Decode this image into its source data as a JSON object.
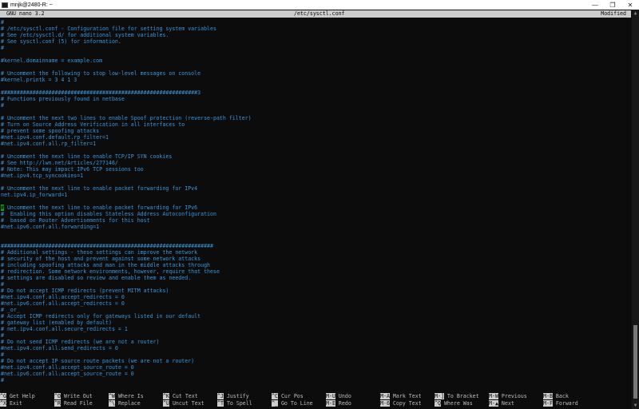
{
  "window": {
    "title": "mnjk@2480-R: ~",
    "minimize_glyph": "—",
    "maximize_glyph": "❐",
    "close_glyph": "✕"
  },
  "nano": {
    "version": "GNU nano 3.2",
    "filename": "/etc/sysctl.conf",
    "status": "Modified"
  },
  "editor": {
    "cursor_line_index": 29,
    "lines": [
      "#",
      "# /etc/sysctl.conf - Configuration file for setting system variables",
      "# See /etc/sysctl.d/ for additional system variables.",
      "# See sysctl.conf (5) for information.",
      "#",
      "",
      "#kernel.domainname = example.com",
      "",
      "# Uncomment the following to stop low-level messages on console",
      "#kernel.printk = 3 4 1 3",
      "",
      "##############################################################3",
      "# Functions previously found in netbase",
      "#",
      "",
      "# Uncomment the next two lines to enable Spoof protection (reverse-path filter)",
      "# Turn on Source Address Verification in all interfaces to",
      "# prevent some spoofing attacks",
      "#net.ipv4.conf.default.rp_filter=1",
      "#net.ipv4.conf.all.rp_filter=1",
      "",
      "# Uncomment the next line to enable TCP/IP SYN cookies",
      "# See http://lwn.net/Articles/277146/",
      "# Note: This may impact IPv6 TCP sessions too",
      "#net.ipv4.tcp_syncookies=1",
      "",
      "# Uncomment the next line to enable packet forwarding for IPv4",
      "net.ipv4.ip_forward=1",
      "",
      "# Uncomment the next line to enable packet forwarding for IPv6",
      "#  Enabling this option disables Stateless Address Autoconfiguration",
      "#  based on Router Advertisements for this host",
      "#net.ipv6.conf.all.forwarding=1",
      "",
      "",
      "###################################################################",
      "# Additional settings - these settings can improve the network",
      "# security of the host and prevent against some network attacks",
      "# including spoofing attacks and man in the middle attacks through",
      "# redirection. Some network environments, however, require that these",
      "# settings are disabled so review and enable them as needed.",
      "#",
      "# Do not accept ICMP redirects (prevent MITM attacks)",
      "#net.ipv4.conf.all.accept_redirects = 0",
      "#net.ipv6.conf.all.accept_redirects = 0",
      "# _or_",
      "# Accept ICMP redirects only for gateways listed in our default",
      "# gateway list (enabled by default)",
      "# net.ipv4.conf.all.secure_redirects = 1",
      "#",
      "# Do not send ICMP redirects (we are not a router)",
      "#net.ipv4.conf.all.send_redirects = 0",
      "#",
      "# Do not accept IP source route packets (we are not a router)",
      "#net.ipv4.conf.all.accept_source_route = 0",
      "#net.ipv6.conf.all.accept_source_route = 0",
      "#"
    ]
  },
  "shortcuts": [
    {
      "key": "^G",
      "label": "Get Help"
    },
    {
      "key": "^X",
      "label": "Exit"
    },
    {
      "key": "^O",
      "label": "Write Out"
    },
    {
      "key": "^R",
      "label": "Read File"
    },
    {
      "key": "^W",
      "label": "Where Is"
    },
    {
      "key": "^\\",
      "label": "Replace"
    },
    {
      "key": "^K",
      "label": "Cut Text"
    },
    {
      "key": "^U",
      "label": "Uncut Text"
    },
    {
      "key": "^J",
      "label": "Justify"
    },
    {
      "key": "^T",
      "label": "To Spell"
    },
    {
      "key": "^C",
      "label": "Cur Pos"
    },
    {
      "key": "^_",
      "label": "Go To Line"
    },
    {
      "key": "M-U",
      "label": "Undo"
    },
    {
      "key": "M-E",
      "label": "Redo"
    },
    {
      "key": "M-A",
      "label": "Mark Text"
    },
    {
      "key": "M-6",
      "label": "Copy Text"
    },
    {
      "key": "M-]",
      "label": "To Bracket"
    },
    {
      "key": "^Q",
      "label": "Where Was"
    },
    {
      "key": "M-W",
      "label": "Previous"
    },
    {
      "key": "M-▲",
      "label": "Next"
    },
    {
      "key": "M-B",
      "label": "Back"
    },
    {
      "key": "M-F",
      "label": "Forward"
    }
  ]
}
